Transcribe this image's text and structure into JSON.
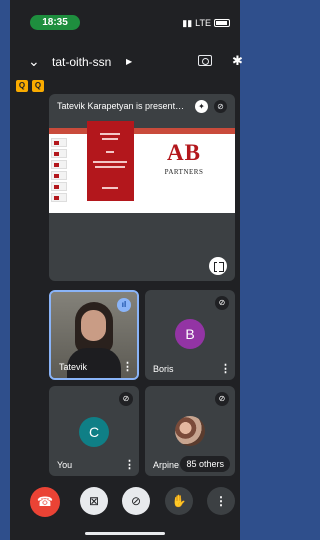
{
  "status_bar": {
    "time": "18:35",
    "network": "LTE"
  },
  "header": {
    "meeting_code": "tat-oith-ssn"
  },
  "badges": [
    "Q",
    "Q"
  ],
  "presentation": {
    "title": "Tatevik Karapetyan is present…",
    "logo_text": "AB",
    "logo_subtext": "PARTNERS"
  },
  "tiles": [
    {
      "name": "Tatevik"
    },
    {
      "name": "Boris",
      "initial": "B",
      "color": "#9334a4"
    },
    {
      "name": "You",
      "initial": "C",
      "color": "#0f7f86"
    },
    {
      "name": "Arpine",
      "others": "85 others"
    }
  ],
  "colors": {
    "end_call": "#ea4335",
    "active_speaker_border": "#8ab4f8",
    "background": "#202124"
  },
  "icons": {
    "end_call": "phone-hangup-icon",
    "camera": "camera-off-icon",
    "mic": "mic-off-icon",
    "hand": "raise-hand-icon",
    "more": "more-vert-icon"
  }
}
